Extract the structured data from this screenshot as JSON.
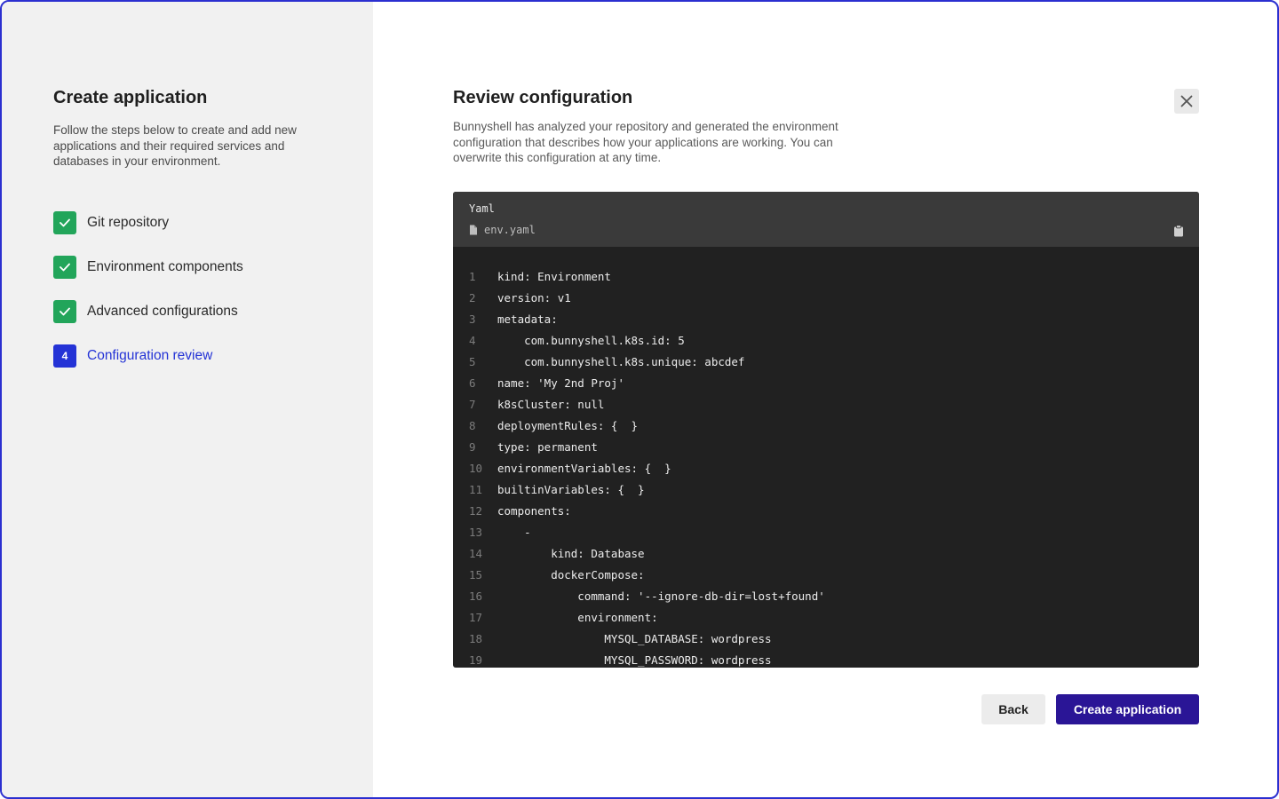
{
  "sidebar": {
    "title": "Create application",
    "description": "Follow the steps below to create and add new applications and their required services and databases in your environment.",
    "steps": [
      {
        "marker": "",
        "label": "Git repository",
        "state": "done"
      },
      {
        "marker": "",
        "label": "Environment components",
        "state": "done"
      },
      {
        "marker": "",
        "label": "Advanced configurations",
        "state": "done"
      },
      {
        "marker": "4",
        "label": "Configuration review",
        "state": "active"
      }
    ]
  },
  "main": {
    "title": "Review configuration",
    "description": "Bunnyshell has analyzed your repository and generated the environment configuration that describes how your applications are working. You can overwrite this configuration at any time.",
    "close_icon": "close-icon"
  },
  "code": {
    "language": "Yaml",
    "filename": "env.yaml",
    "file_icon": "file-icon",
    "copy_icon": "clipboard-icon",
    "lines": [
      {
        "n": "1",
        "text": "kind: Environment"
      },
      {
        "n": "2",
        "text": "version: v1"
      },
      {
        "n": "3",
        "text": "metadata:"
      },
      {
        "n": "4",
        "text": "    com.bunnyshell.k8s.id: 5"
      },
      {
        "n": "5",
        "text": "    com.bunnyshell.k8s.unique: abcdef"
      },
      {
        "n": "6",
        "text": "name: 'My 2nd Proj'"
      },
      {
        "n": "7",
        "text": "k8sCluster: null"
      },
      {
        "n": "8",
        "text": "deploymentRules: {  }"
      },
      {
        "n": "9",
        "text": "type: permanent"
      },
      {
        "n": "10",
        "text": "environmentVariables: {  }"
      },
      {
        "n": "11",
        "text": "builtinVariables: {  }"
      },
      {
        "n": "12",
        "text": "components:"
      },
      {
        "n": "13",
        "text": "    -"
      },
      {
        "n": "14",
        "text": "        kind: Database"
      },
      {
        "n": "15",
        "text": "        dockerCompose:"
      },
      {
        "n": "16",
        "text": "            command: '--ignore-db-dir=lost+found'"
      },
      {
        "n": "17",
        "text": "            environment:"
      },
      {
        "n": "18",
        "text": "                MYSQL_DATABASE: wordpress"
      },
      {
        "n": "19",
        "text": "                MYSQL_PASSWORD: wordpress"
      }
    ]
  },
  "footer": {
    "back_label": "Back",
    "create_label": "Create application"
  },
  "colors": {
    "accent": "#2433d6",
    "done": "#22a55a",
    "primary_button": "#2a1596",
    "code_bg": "#212121",
    "code_header_bg": "#3a3a3a",
    "sidebar_bg": "#f1f1f1"
  }
}
